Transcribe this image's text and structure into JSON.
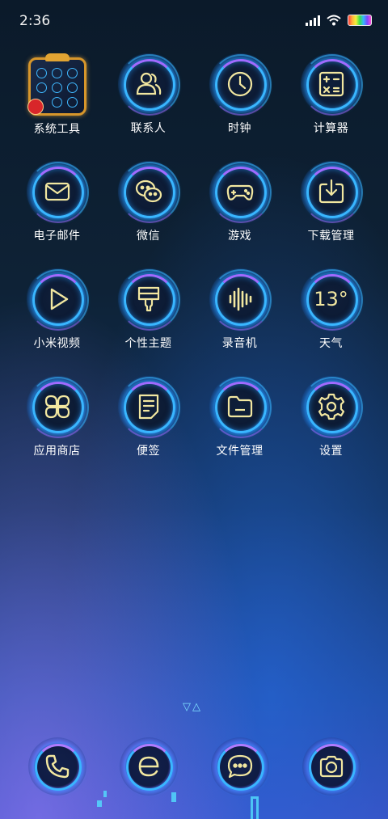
{
  "status_bar": {
    "time": "2:36",
    "icons": [
      "signal-icon",
      "wifi-icon",
      "battery-icon"
    ]
  },
  "apps": [
    {
      "label": "系统工具",
      "icon": "folder-icon"
    },
    {
      "label": "联系人",
      "icon": "contacts-icon"
    },
    {
      "label": "时钟",
      "icon": "clock-icon"
    },
    {
      "label": "计算器",
      "icon": "calculator-icon"
    },
    {
      "label": "电子邮件",
      "icon": "mail-icon"
    },
    {
      "label": "微信",
      "icon": "wechat-icon"
    },
    {
      "label": "游戏",
      "icon": "gamepad-icon"
    },
    {
      "label": "下载管理",
      "icon": "download-icon"
    },
    {
      "label": "小米视频",
      "icon": "play-icon"
    },
    {
      "label": "个性主题",
      "icon": "theme-brush-icon"
    },
    {
      "label": "录音机",
      "icon": "sound-wave-icon"
    },
    {
      "label": "天气",
      "icon": "weather-icon",
      "value": "13°"
    },
    {
      "label": "应用商店",
      "icon": "app-store-icon"
    },
    {
      "label": "便签",
      "icon": "notes-icon"
    },
    {
      "label": "文件管理",
      "icon": "folder-file-icon"
    },
    {
      "label": "设置",
      "icon": "gear-icon"
    }
  ],
  "page_indicator": "▽△",
  "dock": [
    {
      "icon": "phone-icon"
    },
    {
      "icon": "browser-icon"
    },
    {
      "icon": "message-icon"
    },
    {
      "icon": "camera-icon"
    }
  ],
  "colors": {
    "accent_blue": "#39b6ff",
    "accent_purple": "#a06bff",
    "glyph_yellow": "#f2e7a0"
  }
}
